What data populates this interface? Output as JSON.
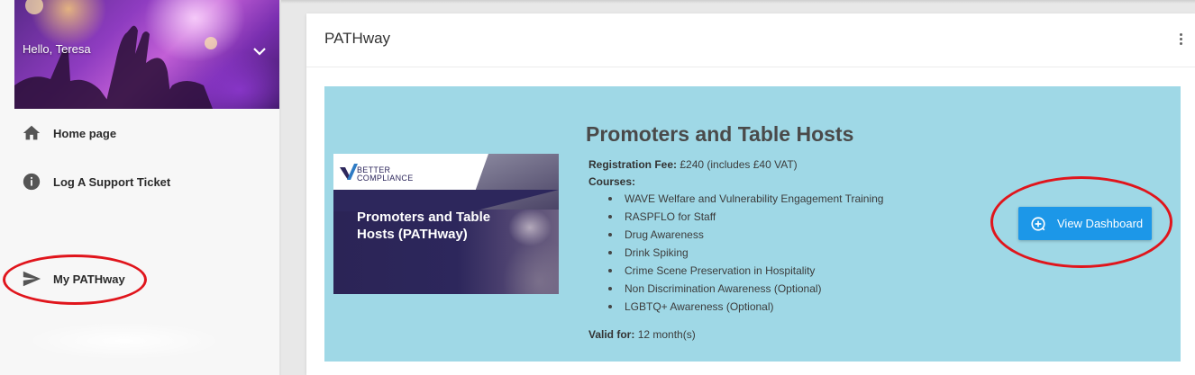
{
  "sidebar": {
    "greeting": "Hello, Teresa",
    "items": [
      {
        "label": "Home page",
        "icon": "home-icon"
      },
      {
        "label": "Log A Support Ticket",
        "icon": "info-icon"
      },
      {
        "label": "My PATHway",
        "icon": "send-icon"
      }
    ]
  },
  "card": {
    "title": "PATHway"
  },
  "pathway": {
    "thumbnail": {
      "brand_line1": "BETTER",
      "brand_line2": "COMPLIANCE",
      "title": "Promoters and Table Hosts (PATHway)"
    },
    "title": "Promoters and Table Hosts",
    "registration_fee_label": "Registration Fee:",
    "registration_fee_value": "£240 (includes £40 VAT)",
    "courses_label": "Courses:",
    "courses": [
      "WAVE Welfare and Vulnerability Engagement Training",
      "RASPFLO for Staff",
      "Drug Awareness",
      "Drink Spiking",
      "Crime Scene Preservation in Hospitality",
      "Non Discrimination Awareness (Optional)",
      "LGBTQ+ Awareness (Optional)"
    ],
    "valid_for_label": "Valid for:",
    "valid_for_value": "12 month(s)",
    "button_label": "View Dashboard",
    "button_icon": "add-circle-icon"
  },
  "colors": {
    "panel_bg": "#9fd8e6",
    "button_bg": "#1c97e8",
    "highlight_ring": "#e0151c",
    "brand_navy": "#2d275c"
  }
}
